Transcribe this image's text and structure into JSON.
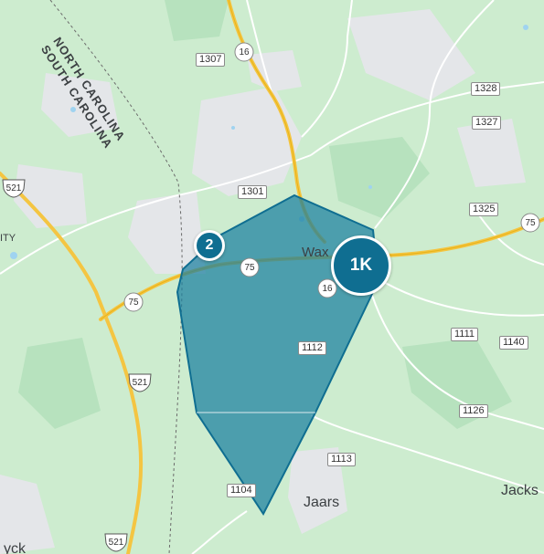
{
  "map": {
    "state_labels": {
      "north": "NORTH CAROLINA",
      "south": "SOUTH CAROLINA"
    },
    "places": {
      "waxhaw": "Wax",
      "jaars": "Jaars",
      "jackson": "Jacks",
      "left_city": "ITY",
      "bottom_left": "yck"
    },
    "route_boxes": [
      "1307",
      "1328",
      "1327",
      "1301",
      "1325",
      "1111",
      "1140",
      "1112",
      "1126",
      "1113",
      "1104"
    ],
    "shields": [
      "16",
      "16",
      "75",
      "75",
      "75",
      "521",
      "521",
      "521"
    ],
    "clusters": [
      {
        "label": "2",
        "color": "#0f6e91"
      },
      {
        "label": "1K",
        "color": "#0f6e91"
      }
    ],
    "outage_area_color": "#1a7fa0"
  }
}
